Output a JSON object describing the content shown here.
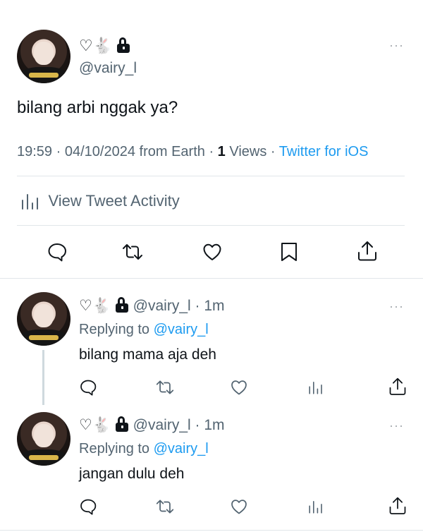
{
  "main_tweet": {
    "display_name_emojis": "♡🐇",
    "handle": "@vairy_l",
    "text": "bilang arbi nggak ya?",
    "time": "19:59",
    "date": "04/10/2024",
    "location": "from Earth",
    "views_count": "1",
    "views_label": "Views",
    "client": "Twitter for iOS",
    "activity_label": "View Tweet Activity",
    "more": "···"
  },
  "replies": [
    {
      "display_name_emojis": "♡🐇",
      "handle": "@vairy_l",
      "age": "1m",
      "replying_prefix": "Replying to",
      "replying_to": "@vairy_l",
      "text": "bilang mama aja deh",
      "more": "···"
    },
    {
      "display_name_emojis": "♡🐇",
      "handle": "@vairy_l",
      "age": "1m",
      "replying_prefix": "Replying to",
      "replying_to": "@vairy_l",
      "text": "jangan dulu deh",
      "more": "···"
    }
  ],
  "icons": {
    "reply": "comment-icon",
    "retweet": "retweet-icon",
    "like": "heart-icon",
    "bookmark": "bookmark-icon",
    "share": "share-icon",
    "analytics": "bar-chart-icon",
    "lock": "lock-icon"
  },
  "colors": {
    "link": "#1d9bf0",
    "text": "#0f1419",
    "secondary": "#536471",
    "divider": "#e1e6ea"
  }
}
